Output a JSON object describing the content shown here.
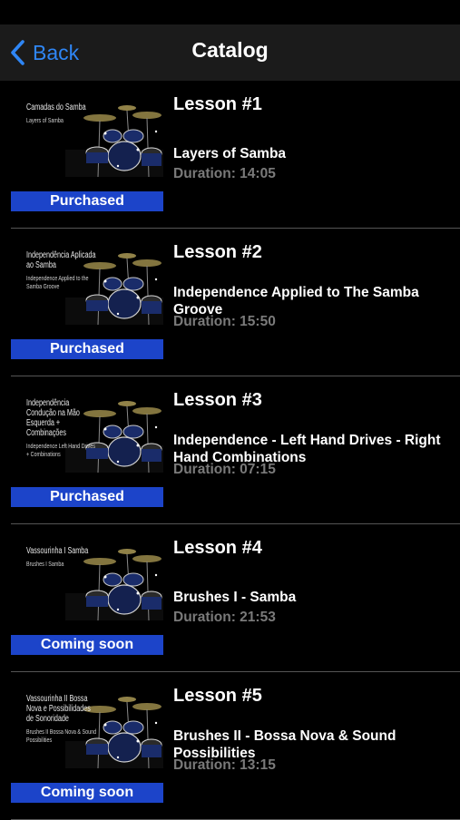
{
  "nav": {
    "back_label": "Back",
    "title": "Catalog",
    "accent_color": "#2f86f5"
  },
  "lessons": [
    {
      "title": "Lesson #1",
      "name": "Layers of Samba",
      "duration": "Duration: 14:05",
      "status": "Purchased",
      "thumb_title": "Camadas do Samba",
      "thumb_subtitle": "Layers of Samba",
      "progress": 0.2
    },
    {
      "title": "Lesson #2",
      "name": "Independence Applied to The Samba Groove",
      "duration": "Duration: 15:50",
      "status": "Purchased",
      "thumb_title": "Independência Aplicada ao Samba",
      "thumb_subtitle": "Independence Applied to the Samba Groove",
      "progress": 0.2
    },
    {
      "title": "Lesson #3",
      "name": "Independence - Left Hand Drives - Right Hand Combinations",
      "duration": "Duration: 07:15",
      "status": "Purchased",
      "thumb_title": "Independência Condução na Mão Esquerda + Combinações",
      "thumb_subtitle": "Independence Left Hand Drives + Combinations",
      "progress": 0.2
    },
    {
      "title": "Lesson #4",
      "name": "Brushes I - Samba",
      "duration": "Duration: 21:53",
      "status": "Coming soon",
      "thumb_title": "Vassourinha I Samba",
      "thumb_subtitle": "Brushes I Samba",
      "progress": 0.2
    },
    {
      "title": "Lesson #5",
      "name": "Brushes II - Bossa Nova & Sound Possibilities",
      "duration": "Duration: 13:15",
      "status": "Coming soon",
      "thumb_title": "Vassourinha II Bossa Nova e Possibilidades de Sonoridade",
      "thumb_subtitle": "Brushes II Bossa Nova & Sound Possibilities",
      "progress": 0.2
    }
  ]
}
